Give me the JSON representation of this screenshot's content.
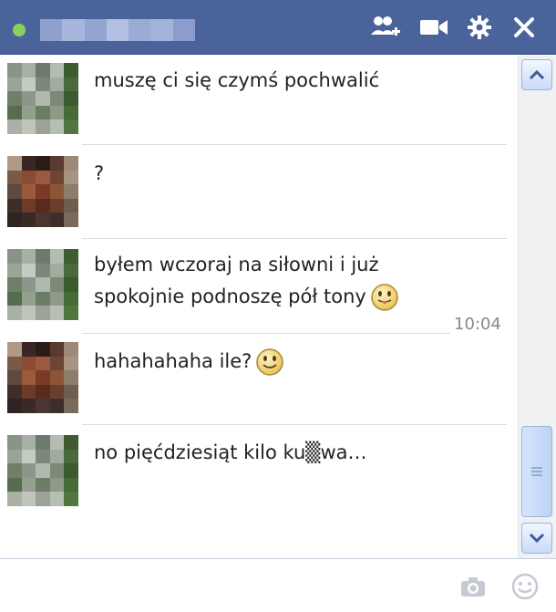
{
  "header": {
    "title": "",
    "status": "online",
    "icons": [
      "add-friends-icon",
      "video-call-icon",
      "gear-icon",
      "close-icon"
    ]
  },
  "messages": [
    {
      "text": "muszę ci się czymś pochwalić",
      "sender": "self"
    },
    {
      "text": "?",
      "sender": "other"
    },
    {
      "text": "byłem wczoraj na siłowni i już\nspokojnie podnoszę pół tony",
      "sender": "self",
      "emoji": "tongue-smiley"
    },
    {
      "text": "hahahahaha ile?",
      "sender": "other",
      "emoji": "smiley"
    },
    {
      "text": "no pięćdziesiąt kilo ku▒wa…",
      "sender": "self"
    }
  ],
  "timestamp": "10:04",
  "composer": {
    "placeholder": "",
    "icons": [
      "camera-icon",
      "emoji-picker-icon"
    ]
  },
  "colors": {
    "header_bg": "#4b639b",
    "online": "#8ad15a",
    "divider": "#d9dde5"
  }
}
